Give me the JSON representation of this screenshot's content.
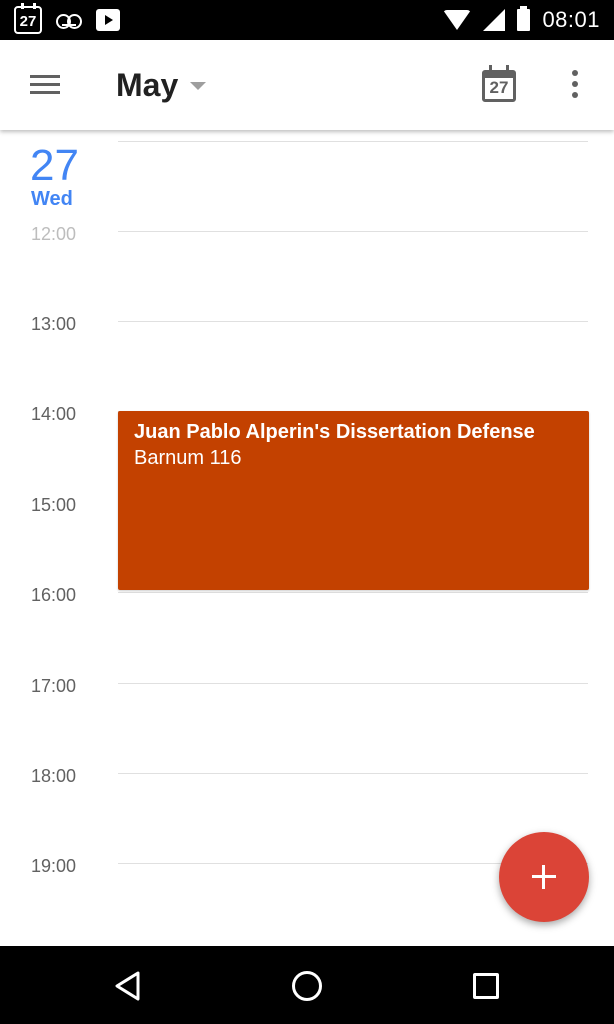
{
  "status_bar": {
    "calendar_day": "27",
    "time": "08:01",
    "icons": [
      "calendar-icon",
      "voicemail-icon",
      "play-store-icon",
      "wifi-icon",
      "signal-icon",
      "battery-icon"
    ]
  },
  "app_bar": {
    "title": "May",
    "today_day": "27",
    "icons": [
      "menu-icon",
      "dropdown-caret-icon",
      "today-calendar-icon",
      "more-vert-icon"
    ]
  },
  "day": {
    "number": "27",
    "weekday": "Wed"
  },
  "hours": [
    "12:00",
    "13:00",
    "14:00",
    "15:00",
    "16:00",
    "17:00",
    "18:00",
    "19:00"
  ],
  "event": {
    "title": "Juan Pablo Alperin's Dissertation Defense",
    "location": "Barnum 116",
    "start": "14:00",
    "end": "16:00",
    "color": "#c34100"
  },
  "fab": {
    "icon": "plus-icon",
    "color": "#db4437"
  },
  "colors": {
    "accent": "#4285f4",
    "status_bar": "#000000",
    "nav_bar": "#000000"
  },
  "nav_bar": {
    "icons": [
      "back-icon",
      "home-icon",
      "recents-icon"
    ]
  }
}
